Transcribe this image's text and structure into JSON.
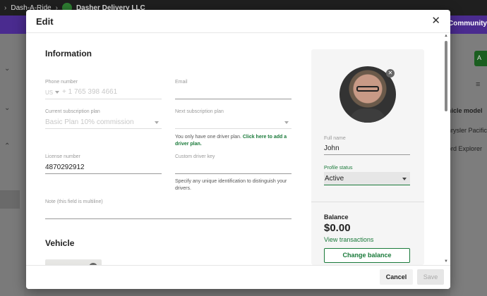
{
  "background": {
    "breadcrumb": [
      "Dash-A-Ride",
      "Dasher Delivery LLC"
    ],
    "banner_text": "re Community",
    "add_button": "A",
    "vehicle_column_header": "hicle model",
    "vehicle_rows": [
      "hrysler Pacifica",
      "ord Explorer"
    ]
  },
  "modal": {
    "title": "Edit",
    "close_icon": "close-icon",
    "information": {
      "heading": "Information",
      "phone_label": "Phone number",
      "phone_country": "US",
      "phone_placeholder": "+ 1 765 398 4661",
      "email_label": "Email",
      "email_value": "",
      "current_plan_label": "Current subscription plan",
      "current_plan_value": "Basic Plan 10% commission",
      "next_plan_label": "Next subscription plan",
      "next_plan_value": "",
      "plan_hint": "You only have one driver plan.",
      "plan_hint_link": "Click here to add a driver plan.",
      "license_label": "License number",
      "license_value": "4870292912",
      "custom_key_label": "Custom driver key",
      "custom_key_value": "",
      "custom_key_hint": "Specify any unique identification to distinguish your drivers.",
      "note_label": "Note (this field is multiline)",
      "note_value": ""
    },
    "vehicle": {
      "heading": "Vehicle"
    },
    "profile": {
      "full_name_label": "Full name",
      "full_name_value": "John",
      "status_label": "Profile status",
      "status_value": "Active",
      "balance_label": "Balance",
      "balance_value": "$0.00",
      "view_transactions": "View transactions",
      "change_balance": "Change balance"
    },
    "footer": {
      "cancel": "Cancel",
      "save": "Save"
    }
  },
  "colors": {
    "accent": "#1a7a3a",
    "banner": "#4a2b8f"
  }
}
